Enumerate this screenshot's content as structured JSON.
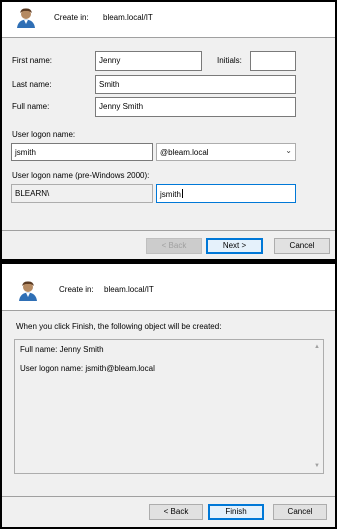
{
  "step1": {
    "create_in_label": "Create in:",
    "create_in_value": "bleam.local/IT",
    "first_name_label": "First name:",
    "first_name_value": "Jenny",
    "initials_label": "Initials:",
    "initials_value": "",
    "last_name_label": "Last name:",
    "last_name_value": "Smith",
    "full_name_label": "Full name:",
    "full_name_value": "Jenny Smith",
    "logon_label": "User logon name:",
    "logon_value": "jsmith",
    "domain_value": "@bleam.local",
    "pre2000_label": "User logon name (pre-Windows 2000):",
    "pre2000_domain": "BLEARN\\",
    "pre2000_value": "jsmith",
    "back_label": "< Back",
    "next_label": "Next >",
    "cancel_label": "Cancel"
  },
  "step2": {
    "create_in_label": "Create in:",
    "create_in_value": "bleam.local/IT",
    "intro_text": "When you click Finish, the following object will be created:",
    "summary_full_name": "Full name: Jenny Smith",
    "summary_logon": "User logon name: jsmith@bleam.local",
    "back_label": "< Back",
    "finish_label": "Finish",
    "cancel_label": "Cancel"
  }
}
